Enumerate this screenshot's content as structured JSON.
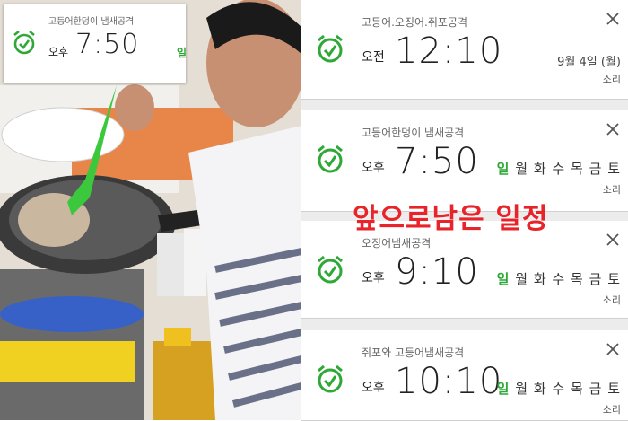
{
  "mini_alarm": {
    "label": "고등어한덩이 냄새공격",
    "ampm": "오후",
    "time": "7:50",
    "days": "일"
  },
  "alarms": [
    {
      "label": "고등어.오징어.쥐포공격",
      "ampm": "오전",
      "time": "12:10",
      "date": "9월 4일 (월)",
      "sound": "소리"
    },
    {
      "label": "고등어한덩이 냄새공격",
      "ampm": "오후",
      "time": "7:50",
      "weekdays": [
        "일",
        "월",
        "화",
        "수",
        "목",
        "금",
        "토"
      ],
      "sound": "소리"
    },
    {
      "label": "오징어냄새공격",
      "ampm": "오후",
      "time": "9:10",
      "weekdays": [
        "일",
        "월",
        "화",
        "수",
        "목",
        "금",
        "토"
      ],
      "sound": "소리"
    },
    {
      "label": "쥐포와 고등어냄새공격",
      "ampm": "오후",
      "time": "10:10",
      "weekdays": [
        "일",
        "월",
        "화",
        "수",
        "목",
        "금",
        "토"
      ],
      "sound": "소리"
    }
  ],
  "overlay": "앞으로남은 일정",
  "colors": {
    "accent": "#2ea836",
    "overlay": "#e8242a"
  }
}
